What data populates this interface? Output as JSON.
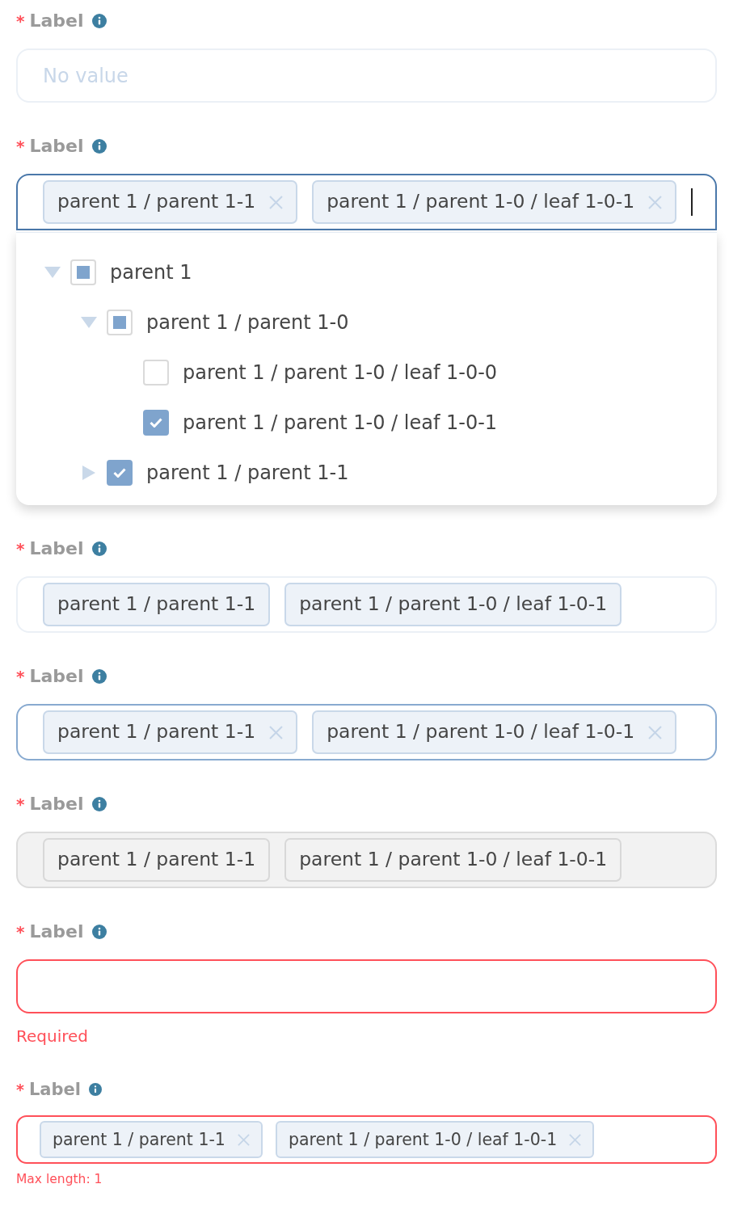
{
  "fields": [
    {
      "kind": "default",
      "required_mark": "*",
      "label": "Label",
      "compact": false,
      "placeholder": "No value"
    },
    {
      "kind": "focused",
      "required_mark": "*",
      "label": "Label",
      "compact": false,
      "tags": [
        {
          "text": "parent 1 / parent 1-1",
          "removable": true
        },
        {
          "text": "parent 1 / parent 1-0 / leaf 1-0-1",
          "removable": true
        }
      ],
      "dropdown": {
        "tree": [
          {
            "kind": "branch",
            "label": "parent 1",
            "expanded": true,
            "checked": false,
            "indeterminate": true,
            "children": [
              {
                "kind": "branch",
                "label": "parent 1 / parent 1-0",
                "expanded": true,
                "checked": false,
                "indeterminate": true,
                "children": [
                  {
                    "kind": "leaf",
                    "label": "parent 1 / parent 1-0 / leaf 1-0-0",
                    "checked": false,
                    "indeterminate": false
                  },
                  {
                    "kind": "leaf",
                    "label": "parent 1 / parent 1-0 / leaf 1-0-1",
                    "checked": true,
                    "indeterminate": false
                  }
                ]
              },
              {
                "kind": "branch",
                "label": "parent 1 / parent 1-1",
                "expanded": false,
                "checked": true,
                "indeterminate": false
              }
            ]
          }
        ]
      }
    },
    {
      "kind": "readonly",
      "required_mark": "*",
      "label": "Label",
      "compact": false,
      "tags": [
        {
          "text": "parent 1 / parent 1-1",
          "removable": false
        },
        {
          "text": "parent 1 / parent 1-0 / leaf 1-0-1",
          "removable": false
        }
      ]
    },
    {
      "kind": "hover",
      "required_mark": "*",
      "label": "Label",
      "compact": false,
      "tags": [
        {
          "text": "parent 1 / parent 1-1",
          "removable": true
        },
        {
          "text": "parent 1 / parent 1-0 / leaf 1-0-1",
          "removable": true
        }
      ]
    },
    {
      "kind": "disabled",
      "required_mark": "*",
      "label": "Label",
      "compact": false,
      "tags": [
        {
          "text": "parent 1 / parent 1-1",
          "removable": false
        },
        {
          "text": "parent 1 / parent 1-0 / leaf 1-0-1",
          "removable": false
        }
      ]
    },
    {
      "kind": "error",
      "required_mark": "*",
      "label": "Label",
      "compact": false,
      "error": "Required"
    },
    {
      "kind": "error",
      "required_mark": "*",
      "label": "Label",
      "compact": true,
      "tags": [
        {
          "text": "parent 1 / parent 1-1",
          "removable": true
        },
        {
          "text": "parent 1 / parent 1-0 / leaf 1-0-1",
          "removable": true
        }
      ],
      "error": "Max length: 1"
    }
  ]
}
